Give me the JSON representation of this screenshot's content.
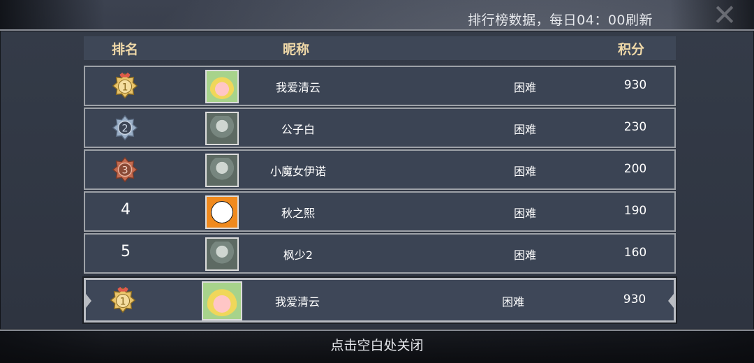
{
  "refresh_note": "排行榜数据，每日04：00刷新",
  "header": {
    "rank": "排名",
    "nickname": "昵称",
    "score": "积分"
  },
  "rows": [
    {
      "rank": "1",
      "nickname": "我爱清云",
      "difficulty": "困难",
      "score": "930",
      "medal": "gold",
      "avatar": "blonde-hero-avatar"
    },
    {
      "rank": "2",
      "nickname": "公子白",
      "difficulty": "困难",
      "score": "230",
      "medal": "silver",
      "avatar": "wolf-hood-avatar"
    },
    {
      "rank": "3",
      "nickname": "小魔女伊诺",
      "difficulty": "困难",
      "score": "200",
      "medal": "bronze",
      "avatar": "wolf-hood-avatar"
    },
    {
      "rank": "4",
      "nickname": "秋之熙",
      "difficulty": "困难",
      "score": "190",
      "medal": "",
      "avatar": "cat-avatar"
    },
    {
      "rank": "5",
      "nickname": "枫少2",
      "difficulty": "困难",
      "score": "160",
      "medal": "",
      "avatar": "wolf-hood-avatar"
    }
  ],
  "my_row": {
    "rank": "1",
    "nickname": "我爱清云",
    "difficulty": "困难",
    "score": "930",
    "medal": "gold",
    "avatar": "blonde-hero-avatar"
  },
  "footer": "点击空白处关闭",
  "colors": {
    "gold": "#e9c46a",
    "silver": "#9bb0c8",
    "bronze": "#c46a4e",
    "header_text": "#f0d9a8"
  }
}
